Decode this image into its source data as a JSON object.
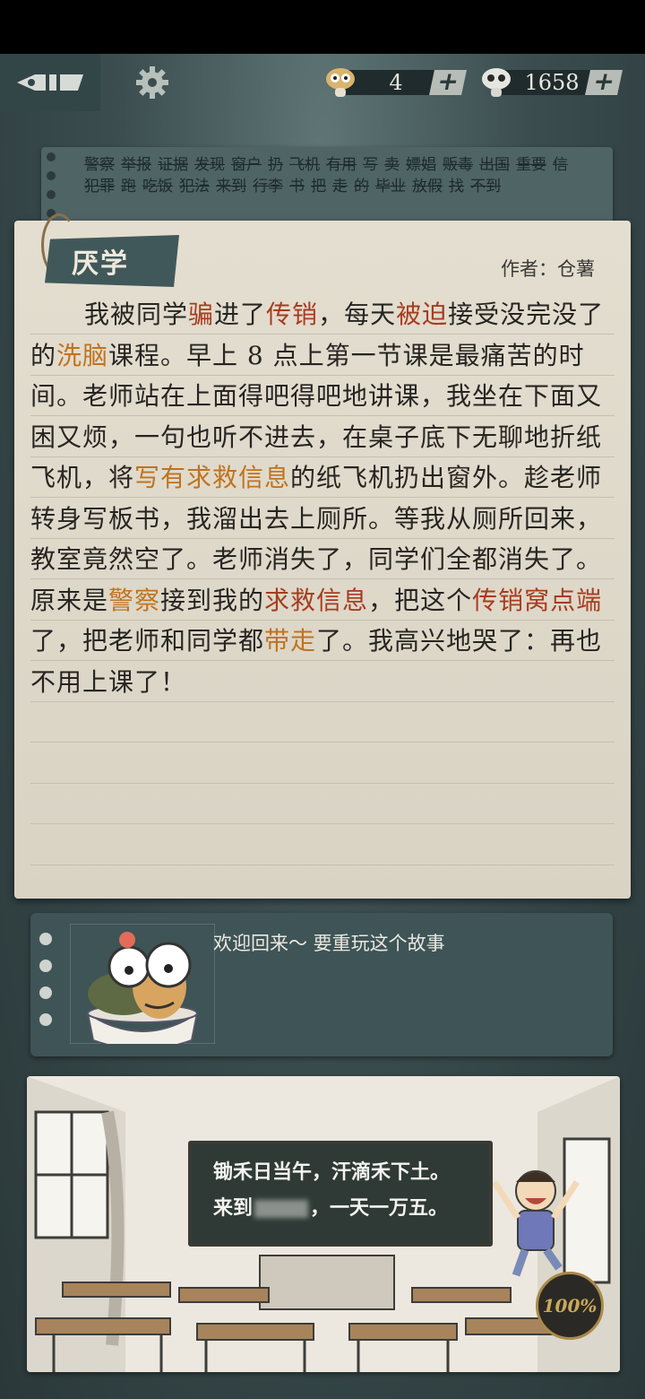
{
  "topbar": {
    "back_icon": "back-pen-icon",
    "settings_icon": "gear-icon",
    "currency_a": {
      "icon": "mushroom-icon",
      "value": "4",
      "plus": "+"
    },
    "currency_b": {
      "icon": "skull-mushroom-icon",
      "value": "1658",
      "plus": "+"
    }
  },
  "keywords": [
    "警察",
    "举报",
    "证据",
    "发现",
    "窗户",
    "扔",
    "飞机",
    "有用",
    "写",
    "卖",
    "嫖娼",
    "贩毒",
    "出国",
    "重要",
    "信",
    "犯罪",
    "跑",
    "吃饭",
    "犯法",
    "来到",
    "行李",
    "书",
    "把",
    "走",
    "的",
    "毕业",
    "放假",
    "找",
    "不到"
  ],
  "story": {
    "title": "厌学",
    "author": "作者：仓薯",
    "segments": [
      {
        "t": "我被同学",
        "c": ""
      },
      {
        "t": "骗",
        "c": "red"
      },
      {
        "t": "进了",
        "c": ""
      },
      {
        "t": "传销",
        "c": "red"
      },
      {
        "t": "，每天",
        "c": ""
      },
      {
        "t": "被迫",
        "c": "red"
      },
      {
        "t": "接受没完没了的",
        "c": ""
      },
      {
        "t": "洗脑",
        "c": "orange"
      },
      {
        "t": "课程。早上 8 点上第一节课是最痛苦的时间。老师站在上面得吧得吧地讲课，我坐在下面又困又烦，一句也听不进去，在桌子底下无聊地折纸飞机，将",
        "c": ""
      },
      {
        "t": "写有求救信息",
        "c": "orange"
      },
      {
        "t": "的纸飞机扔出窗外。趁老师转身写板书，我溜出去上厕所。等我从厕所回来，教室竟然空了。老师消失了，同学们全都消失了。原来是",
        "c": ""
      },
      {
        "t": "警察",
        "c": "orange"
      },
      {
        "t": "接到我的",
        "c": ""
      },
      {
        "t": "求救信息",
        "c": "red"
      },
      {
        "t": "，把这个",
        "c": ""
      },
      {
        "t": "传销窝点端",
        "c": "red"
      },
      {
        "t": "了，把老师和同学都",
        "c": ""
      },
      {
        "t": "带走",
        "c": "orange"
      },
      {
        "t": "了。我高兴地哭了：再也不用上课了！",
        "c": ""
      }
    ]
  },
  "dialogue": {
    "text": "欢迎回来～ 要重玩这个故事",
    "portrait": "turtle-in-bowl-character"
  },
  "scene": {
    "chalkboard_line1": "锄禾日当午，汗滴禾下土。",
    "chalkboard_line2_prefix": "来到",
    "chalkboard_line2_suffix": "，一天一万五。",
    "progress": "100%"
  },
  "colors": {
    "accent_red": "#a73c1f",
    "accent_orange": "#c0731e",
    "board": "#3e5456",
    "paper": "#e4ded0"
  }
}
